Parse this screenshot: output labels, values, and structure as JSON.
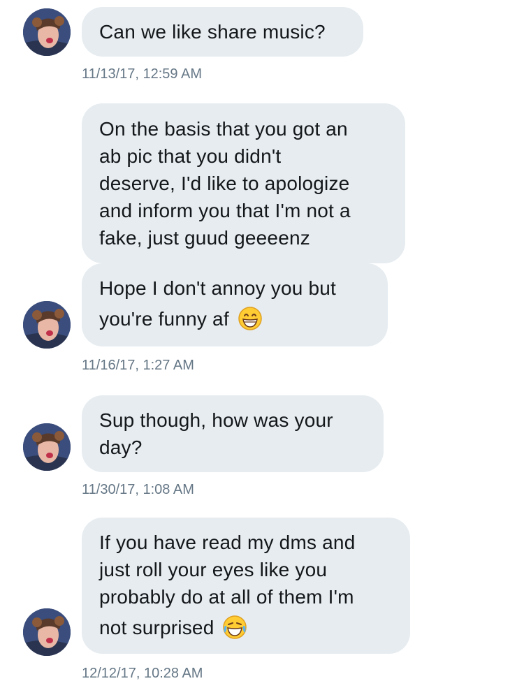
{
  "contact": {
    "avatar_icon": "profile-photo-avatar"
  },
  "messages": [
    {
      "lines": [
        "Can we like share music?"
      ],
      "timestamp": "11/13/17, 12:59 AM"
    },
    {
      "lines": [
        "On the basis that you got an",
        "ab pic that you didn't",
        "deserve, I'd like to apologize",
        "and inform you that I'm not a",
        "fake, just guud geeeenz"
      ]
    },
    {
      "lines": [
        "Hope I don't annoy you but",
        "you're funny af"
      ],
      "emoji": "grinning-face-icon",
      "timestamp": "11/16/17, 1:27 AM"
    },
    {
      "lines": [
        "Sup though, how was your",
        "day?"
      ],
      "timestamp": "11/30/17, 1:08 AM"
    },
    {
      "lines": [
        "If you have read my dms and",
        "just roll your eyes like you",
        "probably do at all of them I'm",
        "not surprised"
      ],
      "emoji": "tears-of-joy-icon",
      "timestamp": "12/12/17, 10:28 AM"
    }
  ]
}
